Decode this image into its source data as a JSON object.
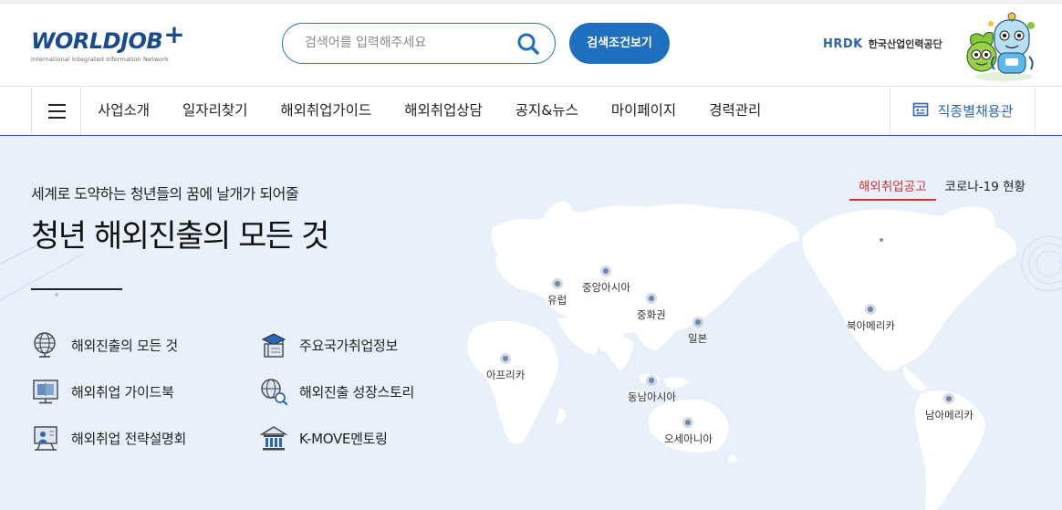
{
  "header": {
    "logo_text": "WORLDJOB",
    "logo_plus": "+",
    "logo_tagline": "International Integrated Information Network",
    "search_placeholder": "검색어를 입력해주세요",
    "search_condition_button": "검색조건보기",
    "partner_logo": "HRDK",
    "partner_name": "한국산업인력공단"
  },
  "nav": {
    "items": [
      "사업소개",
      "일자리찾기",
      "해외취업가이드",
      "해외취업상담",
      "공지&뉴스",
      "마이페이지",
      "경력관리"
    ],
    "right_button": "직종별채용관"
  },
  "hero": {
    "subtitle": "세계로 도약하는 청년들의 꿈에 날개가 되어줄",
    "title": "청년 해외진출의 모든 것",
    "quick_links": [
      {
        "label": "해외진출의 모든 것",
        "icon": "globe-icon"
      },
      {
        "label": "주요국가취업정보",
        "icon": "graduation-book-icon"
      },
      {
        "label": "해외취업 가이드북",
        "icon": "guidebook-monitor-icon"
      },
      {
        "label": "해외진출 성장스토리",
        "icon": "globe-search-icon"
      },
      {
        "label": "해외취업 전략설명회",
        "icon": "presentation-board-icon"
      },
      {
        "label": "K-MOVE멘토링",
        "icon": "institution-building-icon"
      }
    ],
    "tabs": [
      {
        "label": "해외취업공고",
        "active": true
      },
      {
        "label": "코로나-19 현황",
        "active": false
      }
    ],
    "regions": [
      "유럽",
      "중앙아시아",
      "중화권",
      "일본",
      "아프리카",
      "동남아시아",
      "오세아니아",
      "북아메리카",
      "남아메리카"
    ]
  },
  "colors": {
    "brand_blue": "#1f6fc1",
    "nav_accent": "#2c66b8",
    "active_tab_red": "#d3332e",
    "hero_bg": "#e8f0fb"
  }
}
